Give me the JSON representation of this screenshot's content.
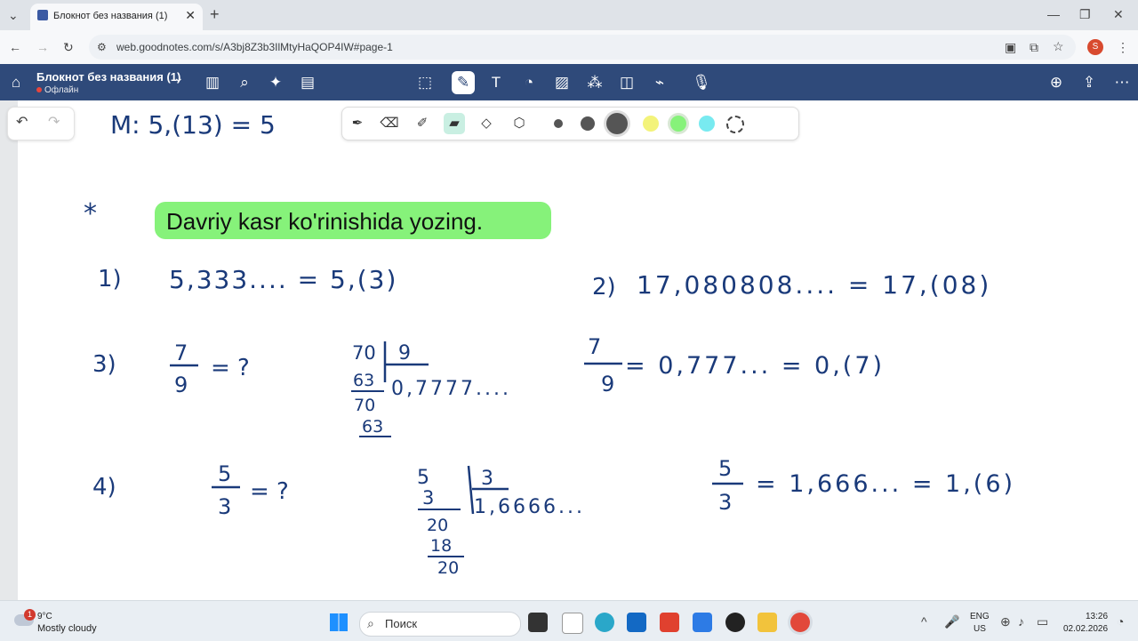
{
  "browser": {
    "tab_title": "Блокнот без названия (1)",
    "new_tab": "+",
    "url": "web.goodnotes.com/s/A3bj8Z3b3IlMtyHaQOP4IW#page-1",
    "profile_initial": "S"
  },
  "app": {
    "doc_title": "Блокнот без названия (1)",
    "status": "Офлайн"
  },
  "page": {
    "banner": "Davriy kasr ko'rinishida yozing.",
    "handwriting": {
      "top": "M:  5,(13) =  5",
      "star": "*",
      "p1_num": "1)",
      "p1": "5,333.... = 5,(3)",
      "p2_num": "2)",
      "p2": "17,080808.... = 17,(08)",
      "p3_num": "3)",
      "p3_frac_num": "7",
      "p3_frac_den": "9",
      "p3_q": "= ?",
      "p3_div": [
        "70",
        "9",
        "63",
        "0,7777....",
        "70",
        "63"
      ],
      "p3_answer": "= 0,777... = 0,(7)",
      "p4_num": "4)",
      "p4_frac_num": "5",
      "p4_frac_den": "3",
      "p4_q": "= ?",
      "p4_div": [
        "5",
        "3",
        "3",
        "1,6666...",
        "20",
        "18",
        "20"
      ],
      "p4_answer": "= 1,666... = 1,(6)"
    }
  },
  "taskbar": {
    "weather_badge": "1",
    "temperature": "9°C",
    "condition": "Mostly cloudy",
    "search": "Поиск",
    "lang": "ENG",
    "layout": "US",
    "time": "13:26",
    "date": "02.02.2026"
  },
  "colors": {
    "appbar": "#2f4a7a",
    "ink": "#1a3a7a",
    "highlight": "#86f27a"
  }
}
